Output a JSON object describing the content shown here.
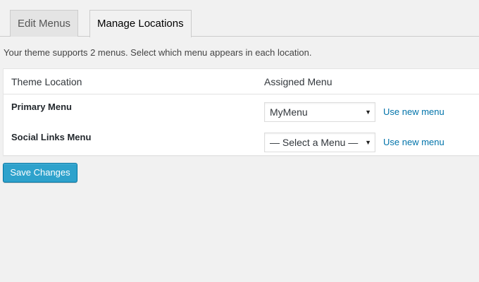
{
  "tabs": [
    {
      "label": "Edit Menus",
      "active": false
    },
    {
      "label": "Manage Locations",
      "active": true
    }
  ],
  "intro_text": "Your theme supports 2 menus. Select which menu appears in each location.",
  "table": {
    "headers": {
      "location": "Theme Location",
      "assigned": "Assigned Menu"
    },
    "rows": [
      {
        "location": "Primary Menu",
        "selected": "MyMenu",
        "link": "Use new menu"
      },
      {
        "location": "Social Links Menu",
        "selected": "— Select a Menu —",
        "link": "Use new menu"
      }
    ]
  },
  "save_button": "Save Changes",
  "icons": {
    "select_arrow": "dropdown-arrow-icon"
  },
  "colors": {
    "accent_button": "#2ea2cc",
    "link": "#0073aa",
    "background": "#f1f1f1"
  }
}
